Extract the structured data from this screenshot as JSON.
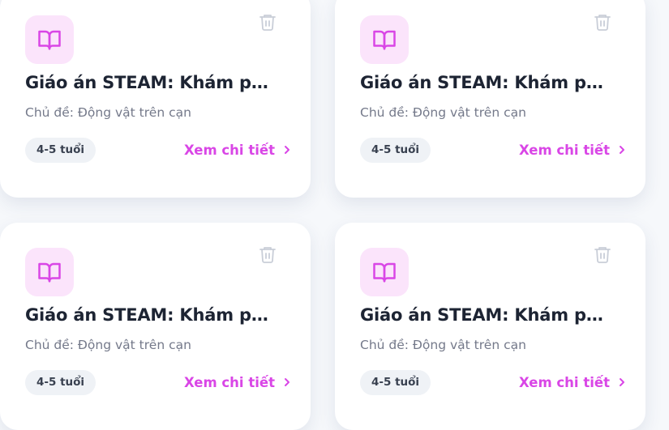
{
  "colors": {
    "accent": "#d946e6",
    "icon_bg": "#fbe4fb",
    "badge_bg": "#eff2f6",
    "title": "#1d2433",
    "subtitle": "#74798a",
    "trash": "#c9ced8"
  },
  "cards": [
    {
      "icon": "book-open-icon",
      "title": "Giáo án STEAM: Khám phá thế giới động vật",
      "subtitle": "Chủ đề: Động vật trên cạn",
      "age_badge": "4-5 tuổi",
      "detail_label": "Xem chi tiết",
      "delete_icon": "trash-icon"
    },
    {
      "icon": "book-open-icon",
      "title": "Giáo án STEAM: Khám phá thế giới động vật",
      "subtitle": "Chủ đề: Động vật trên cạn",
      "age_badge": "4-5 tuổi",
      "detail_label": "Xem chi tiết",
      "delete_icon": "trash-icon"
    },
    {
      "icon": "book-open-icon",
      "title": "Giáo án STEAM: Khám phá thế giới động vật",
      "subtitle": "Chủ đề: Động vật trên cạn",
      "age_badge": "4-5 tuổi",
      "detail_label": "Xem chi tiết",
      "delete_icon": "trash-icon"
    },
    {
      "icon": "book-open-icon",
      "title": "Giáo án STEAM: Khám phá thế giới động vật",
      "subtitle": "Chủ đề: Động vật trên cạn",
      "age_badge": "4-5 tuổi",
      "detail_label": "Xem chi tiết",
      "delete_icon": "trash-icon"
    }
  ]
}
